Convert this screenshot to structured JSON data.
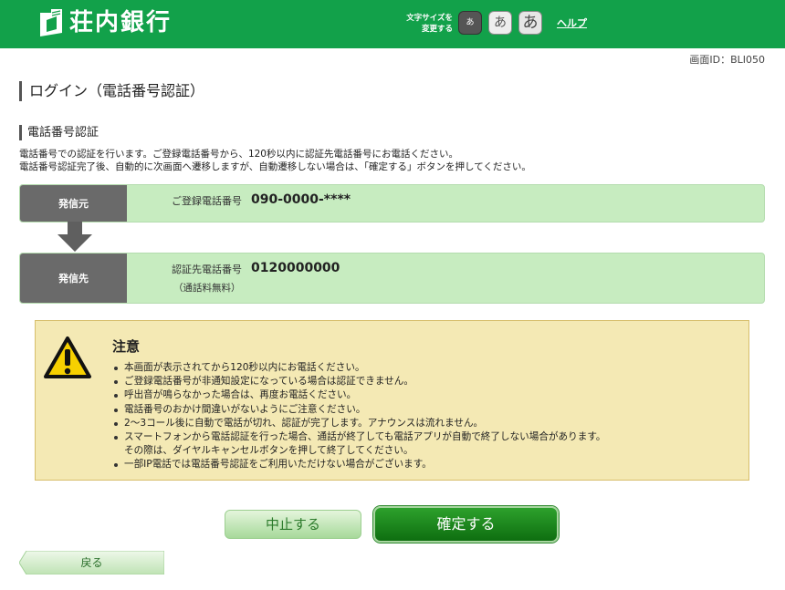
{
  "header": {
    "bank_name": "荘内銀行",
    "font_size_label_line1": "文字サイズを",
    "font_size_label_line2": "変更する",
    "font_small": "あ",
    "font_medium": "あ",
    "font_large": "あ",
    "help": "ヘルプ",
    "brand_color": "#12a14a"
  },
  "screen_id": "画面ID：BLI050",
  "page_title": "ログイン（電話番号認証）",
  "section_title": "電話番号認証",
  "description": [
    "電話番号での認証を行います。ご登録電話番号から、120秒以内に認証先電話番号にお電話ください。",
    "電話番号認証完了後、自動的に次画面へ遷移しますが、自動遷移しない場合は、「確定する」ボタンを押してください。"
  ],
  "caller": {
    "label": "発信元",
    "key": "ご登録電話番号",
    "value": "090-0000-****"
  },
  "destination": {
    "label": "発信先",
    "key": "認証先電話番号",
    "value": "0120000000",
    "note": "（通話料無料）"
  },
  "notice": {
    "icon": "warning-icon",
    "title": "注意",
    "items": [
      "本画面が表示されてから120秒以内にお電話ください。",
      "ご登録電話番号が非通知設定になっている場合は認証できません。",
      "呼出音が鳴らなかった場合は、再度お電話ください。",
      "電話番号のおかけ間違いがないようにご注意ください。",
      "2～3コール後に自動で電話が切れ、認証が完了します。アナウンスは流れません。",
      "スマートフォンから電話認証を行った場合、通話が終了しても電話アプリが自動で終了しない場合があります。",
      "一部IP電話では電話番号認証をご利用いただけない場合がございます。"
    ],
    "item6_line2": "その際は、ダイヤルキャンセルボタンを押して終了してください。"
  },
  "buttons": {
    "cancel": "中止する",
    "confirm": "確定する",
    "back": "戻る"
  }
}
